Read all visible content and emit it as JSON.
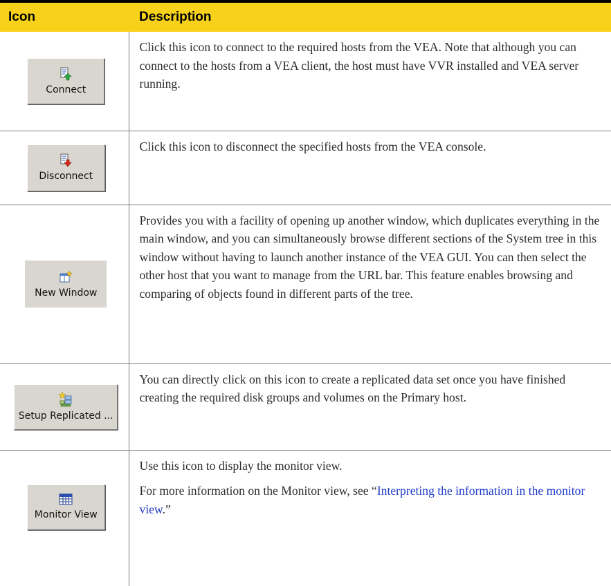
{
  "header": {
    "col_icon": "Icon",
    "col_description": "Description"
  },
  "rows": [
    {
      "button_label": "Connect",
      "icon": "connect-icon",
      "paragraphs": [
        "Click this icon to connect to the required hosts from the VEA. Note that although you can connect to the hosts from a VEA client, the host must have VVR installed and VEA server running."
      ]
    },
    {
      "button_label": "Disconnect",
      "icon": "disconnect-icon",
      "paragraphs": [
        "Click this icon to disconnect the specified hosts from the VEA console."
      ]
    },
    {
      "button_label": "New Window",
      "icon": "new-window-icon",
      "paragraphs": [
        "Provides you with a facility of opening up another window, which duplicates everything in the main window, and you can simultaneously browse different sections of the System tree in this window without having to launch another instance of the VEA GUI. You can then select the other host that you want to manage from the URL bar. This feature enables browsing and comparing of objects found in different parts of the tree."
      ]
    },
    {
      "button_label": "Setup Replicated ...",
      "icon": "setup-replicated-icon",
      "paragraphs": [
        "You can directly click on this icon to create a replicated data set once you have finished creating the required disk groups and volumes on the Primary host."
      ]
    },
    {
      "button_label": "Monitor View",
      "icon": "monitor-view-icon",
      "paragraphs": [
        "Use this icon to display the monitor view."
      ],
      "link_sentence": {
        "prefix": "For more information on the Monitor view, see “",
        "link_text": "Interpreting the information in the monitor view",
        "suffix": ".”"
      }
    }
  ],
  "colors": {
    "header_bg": "#f8d21a",
    "link": "#1e3ac8",
    "text": "#2b2b2b"
  }
}
